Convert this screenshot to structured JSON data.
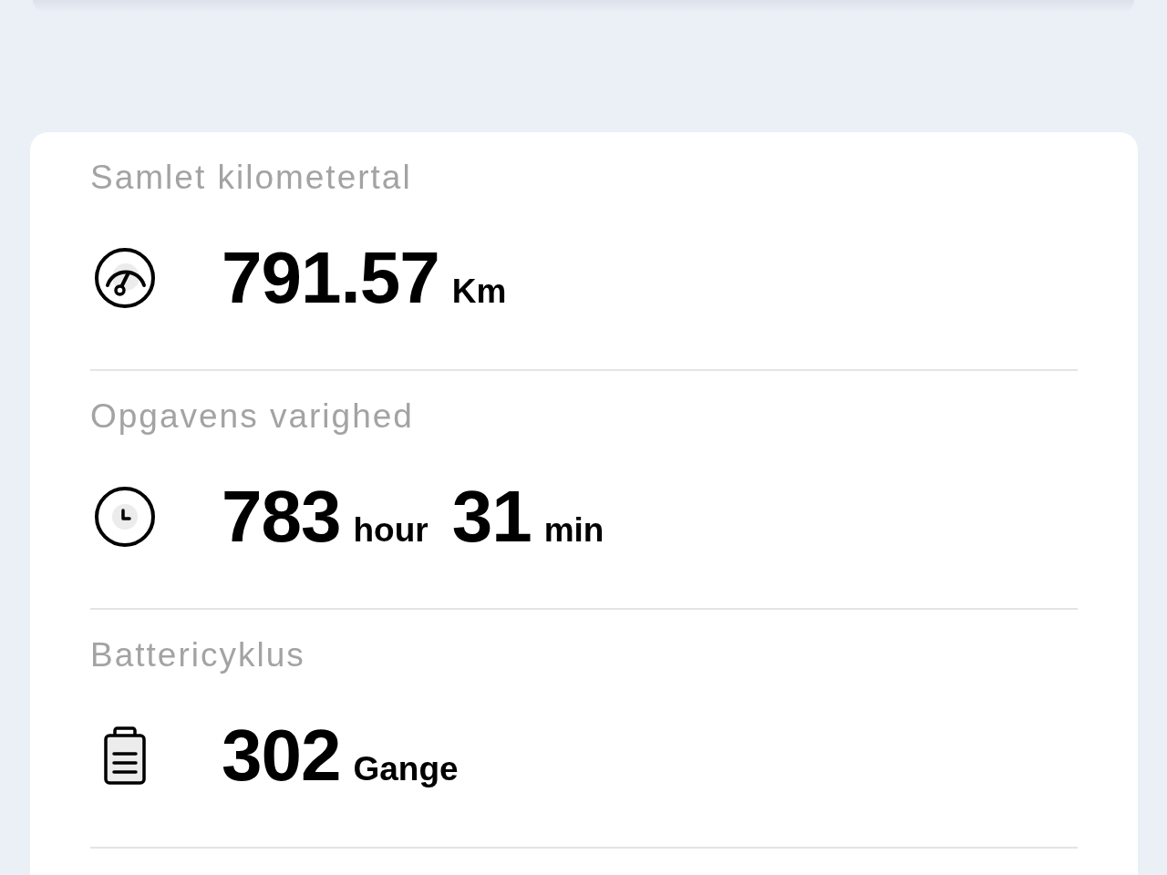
{
  "stats": [
    {
      "kind": "mileage",
      "label": "Samlet kilometertal",
      "values": [
        {
          "number": "791.57",
          "unit": "Km"
        }
      ]
    },
    {
      "kind": "duration",
      "label": "Opgavens varighed",
      "values": [
        {
          "number": "783",
          "unit": "hour"
        },
        {
          "number": "31",
          "unit": "min"
        }
      ]
    },
    {
      "kind": "cycles",
      "label": "Battericyklus",
      "values": [
        {
          "number": "302",
          "unit": "Gange"
        }
      ]
    }
  ]
}
